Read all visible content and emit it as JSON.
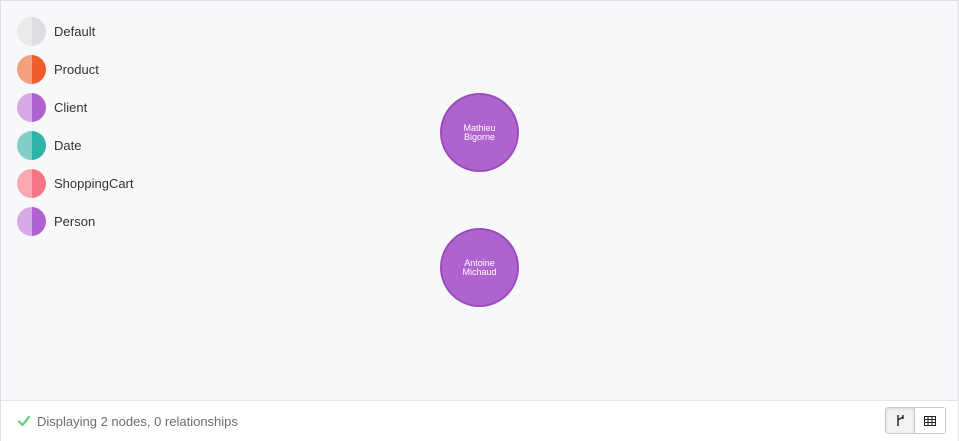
{
  "legend": [
    {
      "label": "Default",
      "colors": [
        "#e9eaec",
        "#dcdde0"
      ]
    },
    {
      "label": "Product",
      "colors": [
        "#f2a07e",
        "#f05d2b"
      ]
    },
    {
      "label": "Client",
      "colors": [
        "#d9a8e6",
        "#b062cf"
      ]
    },
    {
      "label": "Date",
      "colors": [
        "#7fcfc8",
        "#2db3a7"
      ]
    },
    {
      "label": "ShoppingCart",
      "colors": [
        "#f9a7b3",
        "#f67584"
      ]
    },
    {
      "label": "Person",
      "colors": [
        "#d9a8e6",
        "#b062cf"
      ]
    }
  ],
  "nodes": [
    {
      "label": "Mathieu Bigorne",
      "fill": "#b062cf"
    },
    {
      "label": "Antoine Michaud",
      "fill": "#b062cf"
    }
  ],
  "status": {
    "text": "Displaying 2 nodes, 0 relationships",
    "icon": "check-icon",
    "icon_color": "#5fcf80"
  },
  "view_toggle": {
    "options": [
      "graph-view-icon",
      "table-view-icon"
    ],
    "active": "graph-view-icon"
  }
}
